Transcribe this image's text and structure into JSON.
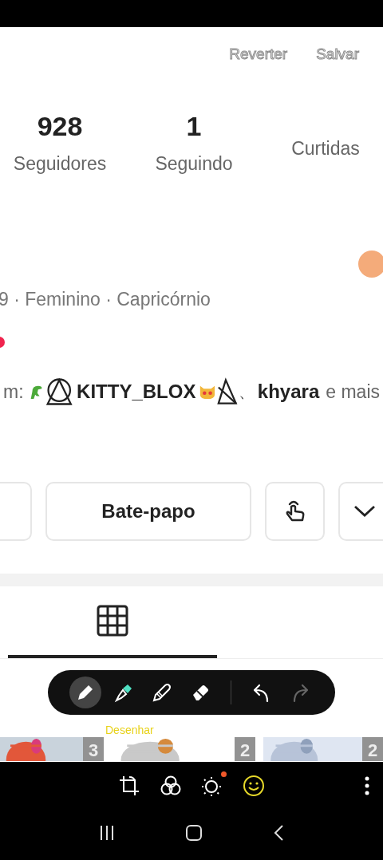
{
  "top_actions": [
    {
      "label": "Reverter"
    },
    {
      "label": "Salvar"
    }
  ],
  "stats": [
    {
      "value": "928",
      "label": "Seguidores"
    },
    {
      "value": "1",
      "label": "Seguindo"
    },
    {
      "label": "Curtidas"
    }
  ],
  "details": "9 · Feminino · Capricórnio",
  "followed_by": {
    "prefix": "m:",
    "first": "KITTY_BLOX",
    "separator": "、",
    "second": "khyara",
    "suffix": "e mais"
  },
  "actions": [
    {
      "kind": "partial"
    },
    {
      "kind": "text",
      "label": "Bate-papo"
    },
    {
      "kind": "poke"
    },
    {
      "kind": "more"
    }
  ],
  "tabs": [
    {
      "kind": "grid",
      "selected": true
    }
  ],
  "draw_toolbar": {
    "tools": [
      {
        "kind": "pen",
        "selected": true
      },
      {
        "kind": "highlighter",
        "selected": false
      },
      {
        "kind": "crayon",
        "selected": false
      },
      {
        "kind": "eraser",
        "selected": false
      }
    ],
    "history": [
      {
        "kind": "undo",
        "disabled": false
      },
      {
        "kind": "redo",
        "disabled": true
      }
    ]
  },
  "overlay_label": "Desenhar",
  "thumbnails": [
    {
      "kind": "picture",
      "count": "3"
    },
    {
      "kind": "picture",
      "count": "2"
    },
    {
      "kind": "picture",
      "count": "2"
    }
  ],
  "editor_bar": [
    {
      "kind": "crop",
      "selected": false
    },
    {
      "kind": "filters",
      "selected": false
    },
    {
      "kind": "adjust",
      "selected": false,
      "badge": true
    },
    {
      "kind": "sticker",
      "selected": true
    },
    {
      "kind": "more",
      "selected": false
    }
  ]
}
